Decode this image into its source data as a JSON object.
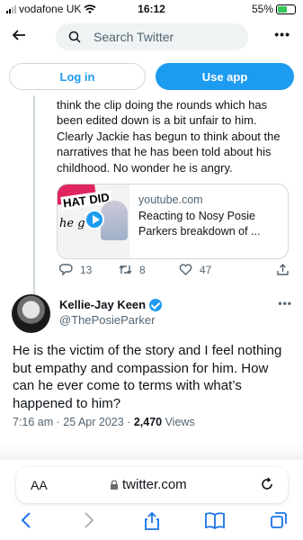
{
  "status": {
    "carrier": "vodafone UK",
    "time": "16:12",
    "battery": "55%"
  },
  "header": {
    "back_icon": "arrow-left-icon",
    "search_placeholder": "Search Twitter"
  },
  "auth": {
    "login_label": "Log in",
    "app_label": "Use app"
  },
  "reply_tweet": {
    "text": "think the clip doing the rounds which has been edited down is a bit unfair to him. Clearly Jackie has begun to think about the narratives that he has been told about his childhood.  No wonder he is angry.",
    "card": {
      "domain": "youtube.com",
      "title": "Reacting to Nosy Posie Parkers breakdown of ...",
      "thumb_text_1": "HAT DID",
      "thumb_text_2": "he g  iu"
    },
    "replies": "13",
    "retweets": "8",
    "likes": "47"
  },
  "main_tweet": {
    "name": "Kellie-Jay Keen",
    "handle": "@ThePosieParker",
    "text": "He is the victim of the story and I feel nothing but empathy and compassion for him.  How can he ever come to terms with what’s happened to him?",
    "timestamp": "7:16 am · 25 Apr 2023 · ",
    "views_count": "2,470",
    "views_label": " Views"
  },
  "browser": {
    "aa_label": "AA",
    "url": "twitter.com"
  },
  "colors": {
    "accent": "#1d9bf0",
    "text": "#0f1419",
    "muted": "#536471"
  }
}
